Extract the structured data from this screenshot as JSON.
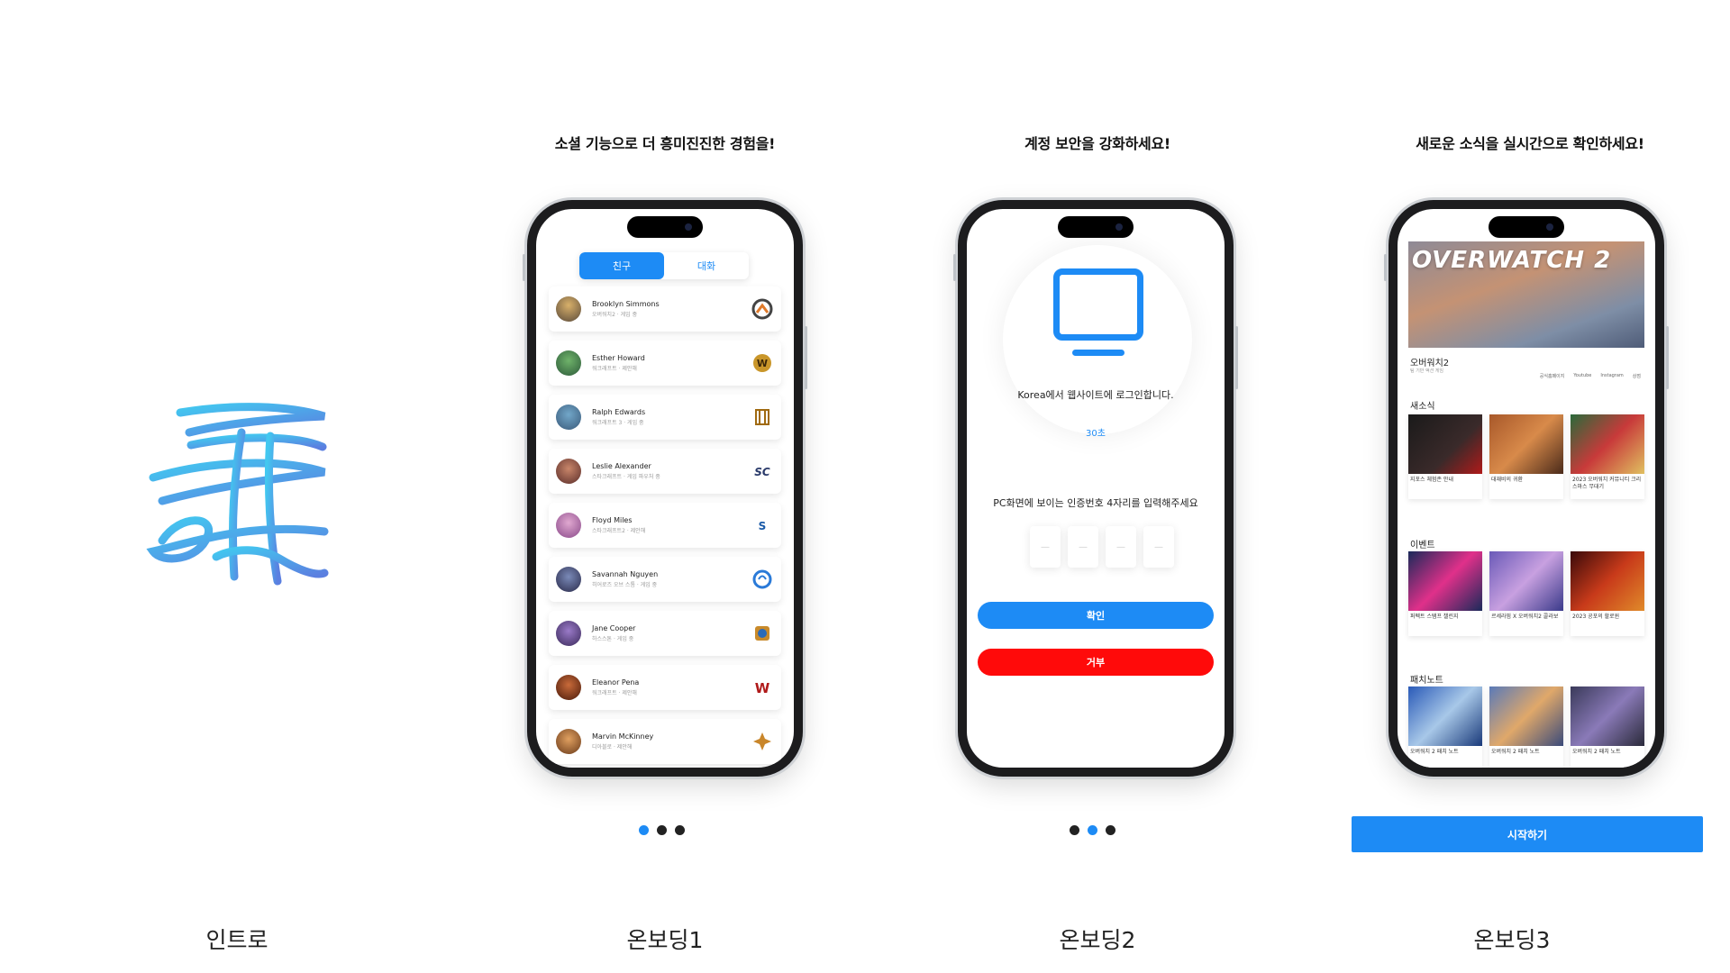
{
  "colors": {
    "accent": "#1d8bf5",
    "reject": "#ff0a0a",
    "dot_inactive": "#222222"
  },
  "intro": {
    "caption": "인트로"
  },
  "onboarding1": {
    "heading": "소셜 기능으로 더 흥미진진한 경험을!",
    "caption": "온보딩1",
    "tabs": [
      "친구",
      "대화"
    ],
    "friends": [
      {
        "name": "Brooklyn Simmons",
        "status": "오버워치2 · 게임 중",
        "icon": "overwatch-icon"
      },
      {
        "name": "Esther Howard",
        "status": "워크래프트 · 제안해",
        "icon": "warcraft-icon"
      },
      {
        "name": "Ralph Edwards",
        "status": "워크래프트 3 · 게임 중",
        "icon": "warcraft3-icon"
      },
      {
        "name": "Leslie Alexander",
        "status": "스타크래프트 · 게임 파우처 중",
        "icon": "starcraft-icon"
      },
      {
        "name": "Floyd Miles",
        "status": "스타크래프트2 · 제안해",
        "icon": "starcraft2-icon"
      },
      {
        "name": "Savannah Nguyen",
        "status": "히어로즈 오브 스톰 · 게임 중",
        "icon": "heroes-icon"
      },
      {
        "name": "Jane Cooper",
        "status": "하스스톤 · 게임 중",
        "icon": "hearthstone-icon"
      },
      {
        "name": "Eleanor Pena",
        "status": "워크래프트 · 제안해",
        "icon": "warcraft-w-icon"
      },
      {
        "name": "Marvin McKinney",
        "status": "디아블로 · 제안해",
        "icon": "diablo-icon"
      }
    ]
  },
  "onboarding2": {
    "heading": "계정 보안을 강화하세요!",
    "caption": "온보딩2",
    "login_text": "Korea에서 웹사이트에 로그인합니다.",
    "timer": "30초",
    "code_prompt": "PC화면에 보이는 인증번호 4자리를 입력해주세요",
    "code_placeholder": "—",
    "confirm_label": "확인",
    "reject_label": "거부"
  },
  "onboarding3": {
    "heading": "새로운 소식을 실시간으로 확인하세요!",
    "caption": "온보딩3",
    "hero_title": "OVERWATCH 2",
    "game_name": "오버워치2",
    "game_sub": "팀 기반 액션 게임",
    "links": [
      "공식홈페이지",
      "Youtube",
      "Instagram",
      "상점"
    ],
    "sections": [
      {
        "title": "새소식",
        "items": [
          "지포스 체험존 안내",
          "대재비의 귀환",
          "2023 오버워치 커뮤니티 크리스마스 무대기"
        ]
      },
      {
        "title": "이벤트",
        "items": [
          "퍼펙트 스탬프 챌린지",
          "르세라핌 X 오버워치2 콜라보",
          "2023 공포의 할로윈"
        ]
      },
      {
        "title": "패치노트",
        "items": [
          "오버워치 2 패치 노트",
          "오버워치 2 패치 노트",
          "오버워치 2 패치 노트"
        ]
      }
    ],
    "start_label": "시작하기"
  }
}
